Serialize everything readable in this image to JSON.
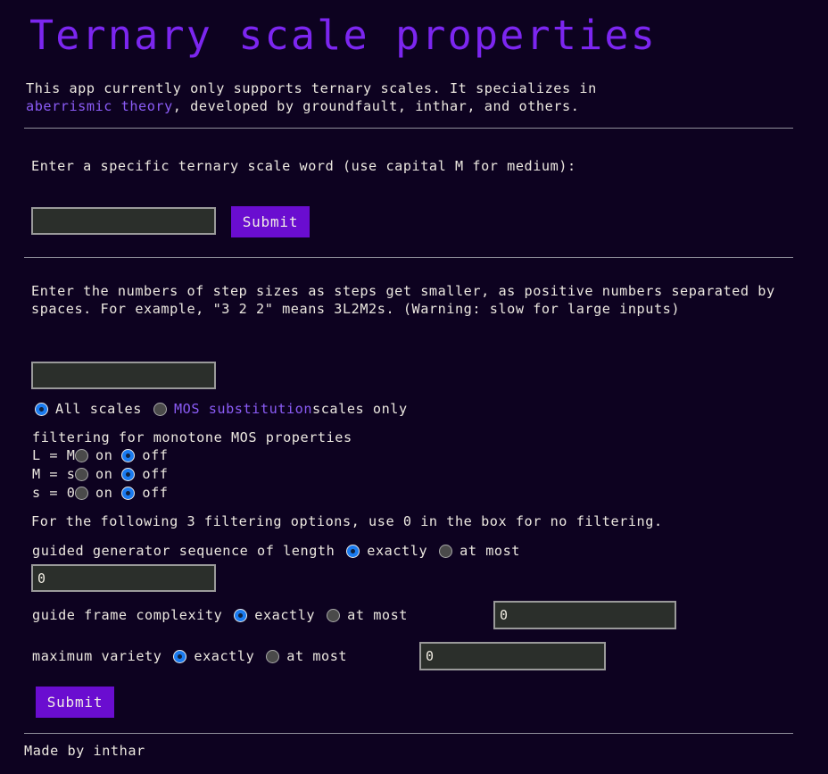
{
  "page": {
    "title": "Ternary scale properties",
    "background_color": "#0d0220",
    "accent_color": "#7c26f0",
    "link_color": "#8b5cf6",
    "text_color": "#ece8e0",
    "radio_on_color": "#1a7bf0"
  },
  "intro": {
    "line1": "This app currently only supports ternary scales. It specializes in",
    "link_text": "aberrismic theory",
    "line2_rest": ", developed by groundfault, inthar, and others."
  },
  "section_word": {
    "label": "Enter a specific ternary scale word (use capital M for medium):",
    "input_value": "",
    "input_placeholder": "",
    "submit_label": "Submit"
  },
  "section_steps": {
    "description": "Enter the numbers of step sizes as steps get smaller, as positive numbers separated by spaces. For example, \"3 2 2\" means 3L2M2s. (Warning: slow for large inputs)",
    "input_value": "",
    "input_placeholder": ""
  },
  "scale_mode": {
    "option_all_label": "All scales",
    "option_mos_link": "MOS substitution",
    "option_mos_rest": " scales only",
    "selected": "all"
  },
  "monotone": {
    "header": "filtering for monotone MOS properties",
    "rows": [
      {
        "name": "L = M",
        "on_label": "on",
        "off_label": "off",
        "selected": "off"
      },
      {
        "name": "M = s",
        "on_label": "on",
        "off_label": "off",
        "selected": "off"
      },
      {
        "name": "s = 0",
        "on_label": "on",
        "off_label": "off",
        "selected": "off"
      }
    ]
  },
  "filtering_note": "For the following 3 filtering options, use 0 in the box for no filtering.",
  "filters": {
    "ggs": {
      "label": "guided generator sequence of length",
      "exactly_label": "exactly",
      "at_most_label": "at most",
      "selected": "exactly",
      "value": "0"
    },
    "gfc": {
      "label": "guide frame complexity",
      "exactly_label": "exactly",
      "at_most_label": "at most",
      "selected": "exactly",
      "value": "0"
    },
    "mv": {
      "label": "maximum variety",
      "exactly_label": "exactly",
      "at_most_label": "at most",
      "selected": "exactly",
      "value": "0"
    }
  },
  "submit_bottom_label": "Submit",
  "footer": "Made by inthar"
}
